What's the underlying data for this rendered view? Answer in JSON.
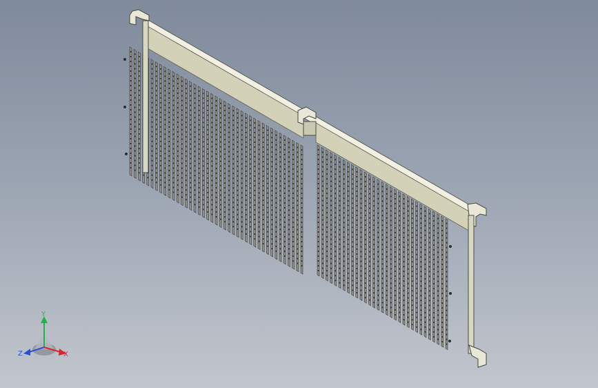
{
  "viewport": {
    "background_top": "#7f8a9b",
    "background_bottom": "#c2c6cd"
  },
  "model": {
    "part_name": "louvered-panel-assembly",
    "panel_face_color": "#d3d2b8",
    "panel_edge_color": "#ecebd9",
    "fin_color": "#8e8f8a",
    "fin_edge_color": "#3a3b38",
    "bracket_color": "#e6e5d4"
  },
  "triad": {
    "x_label": "X",
    "y_label": "Y",
    "z_label": "Z",
    "x_color": "#d8242a",
    "y_color": "#20b34a",
    "z_color": "#2a4fd6"
  }
}
